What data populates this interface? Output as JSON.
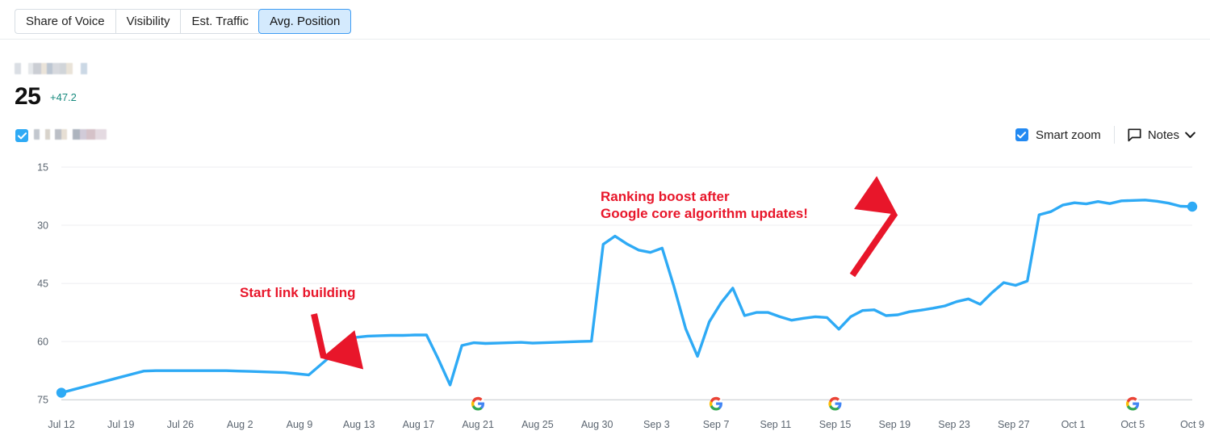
{
  "tabs": [
    {
      "label": "Share of Voice",
      "active": false
    },
    {
      "label": "Visibility",
      "active": false
    },
    {
      "label": "Est. Traffic",
      "active": false
    },
    {
      "label": "Avg. Position",
      "active": true
    }
  ],
  "metric": {
    "value": "25",
    "delta": "+47.2",
    "delta_color": "#178a7e",
    "label_redacted": true
  },
  "legend": {
    "checked": true,
    "label_redacted": true
  },
  "controls": {
    "smart_zoom_label": "Smart zoom",
    "smart_zoom_checked": true,
    "notes_label": "Notes",
    "notes_icon": "note-bubble-icon",
    "notes_chevron": "chevron-down-icon",
    "accent_color": "#2289f2"
  },
  "annotations": [
    {
      "id": "start-link-building",
      "text": "Start link building",
      "color": "#e8162a",
      "arrow": "down"
    },
    {
      "id": "ranking-boost",
      "text": "Ranking boost after\nGoogle core algorithm updates!",
      "color": "#e8162a",
      "arrow": "up-right"
    }
  ],
  "chart_data": {
    "type": "line",
    "title": "",
    "xlabel": "",
    "ylabel": "",
    "series_color": "#2eaaf5",
    "grid": true,
    "legend_position": "top-left",
    "y_inverted": true,
    "yticks": [
      15,
      30,
      45,
      60,
      75
    ],
    "ylim": [
      15,
      76
    ],
    "xticks": [
      "Jul 12",
      "Jul 19",
      "Jul 26",
      "Aug 2",
      "Aug 9",
      "Aug 13",
      "Aug 17",
      "Aug 21",
      "Aug 25",
      "Aug 30",
      "Sep 3",
      "Sep 7",
      "Sep 11",
      "Sep 15",
      "Sep 19",
      "Sep 23",
      "Sep 27",
      "Oct 1",
      "Oct 5",
      "Oct 9"
    ],
    "google_update_markers": [
      "Aug 21",
      "Sep 7",
      "Sep 15",
      "Oct 5"
    ],
    "series": [
      {
        "name": "Avg. Position",
        "x": [
          "Jul 12",
          "Jul 13",
          "Jul 14",
          "Jul 15",
          "Jul 16",
          "Jul 17",
          "Jul 18",
          "Jul 19",
          "Jul 20",
          "Jul 21",
          "Jul 22",
          "Jul 23",
          "Jul 24",
          "Jul 25",
          "Jul 26",
          "Jul 27",
          "Jul 28",
          "Jul 29",
          "Jul 30",
          "Jul 31",
          "Aug 1",
          "Aug 2",
          "Aug 3",
          "Aug 4",
          "Aug 5",
          "Aug 6",
          "Aug 7",
          "Aug 8",
          "Aug 9",
          "Aug 10",
          "Aug 11",
          "Aug 12",
          "Aug 13",
          "Aug 14",
          "Aug 15",
          "Aug 16",
          "Aug 17",
          "Aug 18",
          "Aug 19",
          "Aug 20",
          "Aug 21",
          "Aug 22",
          "Aug 23",
          "Aug 24",
          "Aug 25",
          "Aug 26",
          "Aug 27",
          "Aug 28",
          "Aug 29",
          "Aug 30",
          "Aug 31",
          "Sep 1",
          "Sep 2",
          "Sep 3",
          "Sep 4",
          "Sep 5",
          "Sep 6",
          "Sep 7",
          "Sep 8",
          "Sep 9",
          "Sep 10",
          "Sep 11",
          "Sep 12",
          "Sep 13",
          "Sep 14",
          "Sep 15",
          "Sep 16",
          "Sep 17",
          "Sep 18",
          "Sep 19",
          "Sep 20",
          "Sep 21",
          "Sep 22",
          "Sep 23",
          "Sep 24",
          "Sep 25",
          "Sep 26",
          "Sep 27",
          "Sep 28",
          "Sep 29",
          "Sep 30",
          "Oct 1",
          "Oct 2",
          "Oct 3",
          "Oct 4",
          "Oct 5",
          "Oct 6",
          "Oct 7",
          "Oct 8",
          "Oct 9"
        ],
        "values": [
          73.2,
          72.4,
          71.6,
          70.8,
          70.0,
          69.2,
          68.4,
          67.6,
          67.5,
          67.5,
          67.5,
          67.5,
          67.5,
          67.5,
          67.5,
          67.6,
          67.7,
          67.8,
          67.9,
          68.0,
          68.3,
          68.6,
          66.0,
          63.4,
          60.8,
          58.9,
          58.6,
          58.5,
          58.4,
          58.4,
          58.3,
          58.3,
          64.5,
          71.2,
          61.0,
          60.3,
          60.5,
          60.4,
          60.3,
          60.2,
          60.4,
          60.3,
          60.2,
          60.1,
          60.0,
          59.9,
          34.9,
          32.8,
          34.8,
          36.4,
          37.0,
          35.9,
          45.8,
          56.7,
          63.8,
          54.9,
          50.0,
          46.2,
          53.3,
          52.5,
          52.5,
          53.6,
          54.5,
          54.0,
          53.6,
          53.8,
          56.8,
          53.6,
          52.0,
          51.8,
          53.3,
          53.1,
          52.3,
          51.9,
          51.4,
          50.8,
          49.7,
          49.0,
          50.4,
          47.4,
          44.8,
          45.5,
          44.4,
          27.3,
          26.5,
          24.8,
          24.2,
          24.5,
          23.9,
          24.4,
          23.7,
          23.6,
          23.5,
          23.8,
          24.3,
          25.1,
          25.2
        ]
      }
    ]
  }
}
